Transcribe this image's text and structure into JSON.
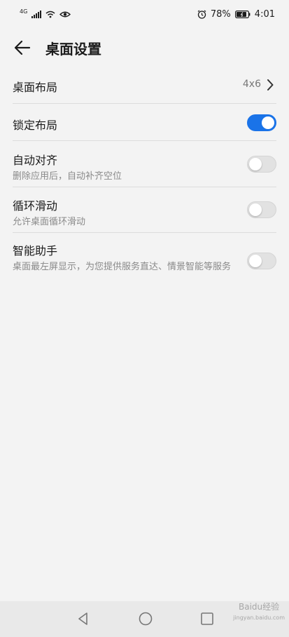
{
  "status_bar": {
    "network": "4G",
    "battery": "78%",
    "time": "4:01",
    "icons": [
      "signal-icon",
      "wifi-icon",
      "eye-icon",
      "alarm-icon",
      "battery-icon"
    ]
  },
  "header": {
    "title": "桌面设置",
    "back_icon": "arrow-left-icon"
  },
  "settings": [
    {
      "title": "桌面布局",
      "value": "4x6",
      "control": "chevron"
    },
    {
      "title": "锁定布局",
      "control": "toggle",
      "on": true
    },
    {
      "title": "自动对齐",
      "subtitle": "删除应用后，自动补齐空位",
      "control": "toggle",
      "on": false
    },
    {
      "title": "循环滑动",
      "subtitle": "允许桌面循环滑动",
      "control": "toggle",
      "on": false
    },
    {
      "title": "智能助手",
      "subtitle": "桌面最左屏显示，为您提供服务直达、情景智能等服务",
      "control": "toggle",
      "on": false
    }
  ],
  "nav_bar": {
    "icons": [
      "nav-back-icon",
      "nav-home-icon",
      "nav-recents-icon"
    ]
  },
  "watermark": {
    "brand": "Baidu",
    "text": "经验",
    "sub": "jingyan.baidu.com"
  },
  "colors": {
    "accent": "#1a73e8",
    "background": "#f3f3f3",
    "nav_background": "#e9e9e9"
  }
}
